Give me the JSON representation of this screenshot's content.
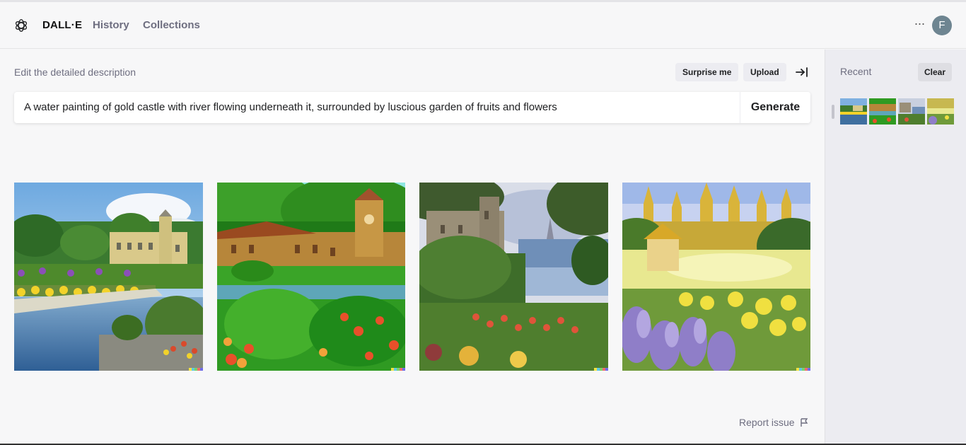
{
  "header": {
    "brand": "DALL·E",
    "nav": [
      "History",
      "Collections"
    ],
    "more_label": "···",
    "avatar_initial": "F"
  },
  "editor": {
    "label": "Edit the detailed description",
    "surprise_label": "Surprise me",
    "upload_label": "Upload",
    "prompt_value": "A water painting of gold castle with river flowing underneath it, surrounded by luscious garden of fruits and flowers",
    "generate_label": "Generate"
  },
  "results": {
    "report_label": "Report issue"
  },
  "sidebar": {
    "recent_label": "Recent",
    "clear_label": "Clear"
  },
  "colors": {
    "accent_signature": [
      "#f4e342",
      "#5ec8e5",
      "#77d36b",
      "#ee6d6d",
      "#6f6de8"
    ]
  }
}
